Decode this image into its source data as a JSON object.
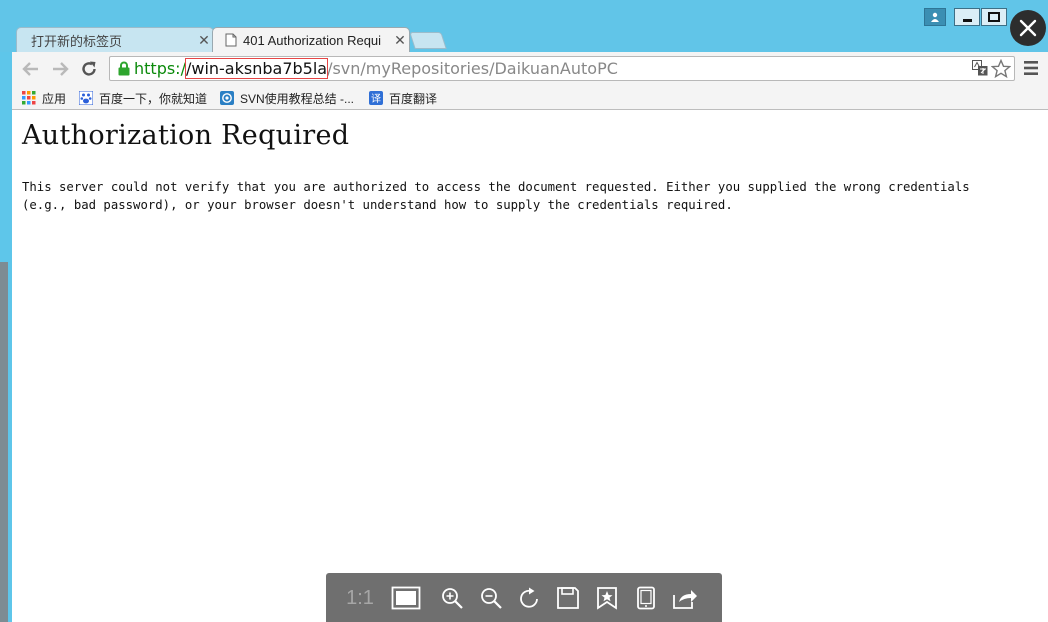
{
  "tabs": [
    {
      "label": "打开新的标签页"
    },
    {
      "label": "401 Authorization Requi"
    }
  ],
  "address_bar": {
    "scheme": "https:/",
    "host": "/win-aksnba7b5la",
    "path": "/svn/myRepositories/DaikuanAutoPC"
  },
  "bookmarks": [
    {
      "label": "应用"
    },
    {
      "label": "百度一下，你就知道"
    },
    {
      "label": "SVN使用教程总结 -..."
    },
    {
      "label": "百度翻译"
    }
  ],
  "page": {
    "heading": "Authorization Required",
    "body": "This server could not verify that you are authorized to access the document requested. Either you supplied the wrong credentials (e.g., bad password), or your browser doesn't understand how to supply the credentials required."
  },
  "viewer": {
    "ratio_label": "1:1"
  },
  "colors": {
    "window_frame": "#61c5e8",
    "url_scheme_green": "#0b8a0b",
    "highlight_box": "#e64545",
    "viewer_bar": "#6f6f6f"
  }
}
